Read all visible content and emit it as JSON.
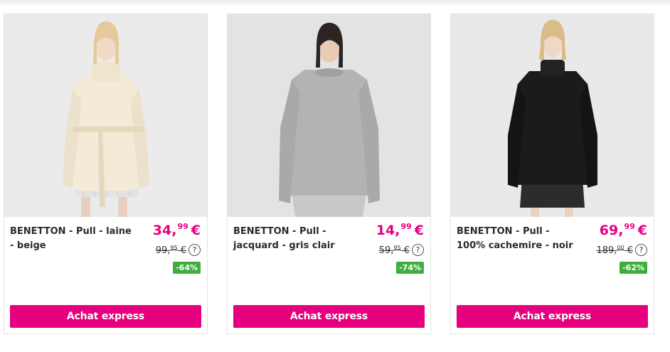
{
  "products": [
    {
      "title": "BENETTON - Pull - laine - beige",
      "price_int": "34,",
      "price_cents": "99",
      "currency": "€",
      "old_price_int": "99,",
      "old_price_cents": "95",
      "help": "?",
      "discount": "-64%",
      "button": "Achat express",
      "image_icon": "product-photo-beige-turtleneck"
    },
    {
      "title": "BENETTON - Pull - jacquard - gris clair",
      "price_int": "14,",
      "price_cents": "99",
      "currency": "€",
      "old_price_int": "59,",
      "old_price_cents": "95",
      "help": "?",
      "discount": "-74%",
      "button": "Achat express",
      "image_icon": "product-photo-grey-sweater"
    },
    {
      "title": "BENETTON - Pull - 100% cachemire - noir",
      "price_int": "69,",
      "price_cents": "99",
      "currency": "€",
      "old_price_int": "189,",
      "old_price_cents": "00",
      "help": "?",
      "discount": "-62%",
      "button": "Achat express",
      "image_icon": "product-photo-black-turtleneck"
    }
  ],
  "colors": {
    "accent": "#e6007e",
    "discount": "#3eae3e"
  }
}
